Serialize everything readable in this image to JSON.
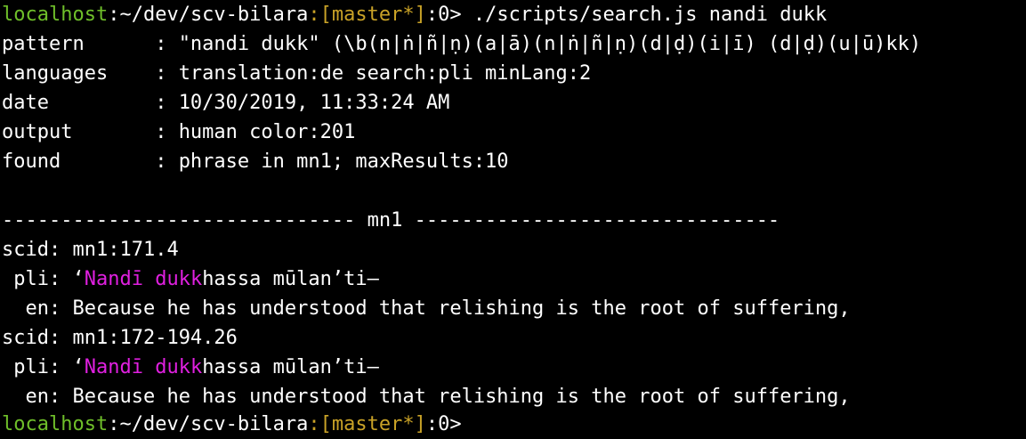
{
  "prompt1": {
    "host": "localhost",
    "sep": ":",
    "path": "~/dev/scv-bilara",
    "branch": ":[master*]",
    "suffix": ":0>",
    "command": " ./scripts/search.js nandi dukk"
  },
  "info": [
    {
      "key": "pattern      ",
      "sep": ": ",
      "value": "\"nandi dukk\" (\\b(n|ṅ|ñ|ṇ)(a|ā)(n|ṅ|ñ|ṇ)(d|ḍ)(i|ī) (d|ḍ)(u|ū)kk)"
    },
    {
      "key": "languages    ",
      "sep": ": ",
      "value": "translation:de search:pli minLang:2"
    },
    {
      "key": "date         ",
      "sep": ": ",
      "value": "10/30/2019, 11:33:24 AM"
    },
    {
      "key": "output       ",
      "sep": ": ",
      "value": "human color:201"
    },
    {
      "key": "found        ",
      "sep": ": ",
      "value": "phrase in mn1; maxResults:10"
    }
  ],
  "divider": "------------------------------ mn1 -------------------------------",
  "results": [
    {
      "scid_label": "scid: ",
      "scid": "mn1:171.4",
      "pli_label": " pli: ",
      "pli_pre": "‘",
      "pli_match": "Nandī dukk",
      "pli_post": "hassa mūlan’ti—",
      "en_label": "  en: ",
      "en": "Because he has understood that relishing is the root of suffering,"
    },
    {
      "scid_label": "scid: ",
      "scid": "mn1:172-194.26",
      "pli_label": " pli: ",
      "pli_pre": "‘",
      "pli_match": "Nandī dukk",
      "pli_post": "hassa mūlan’ti—",
      "en_label": "  en: ",
      "en": "Because he has understood that relishing is the root of suffering,"
    }
  ],
  "prompt2": {
    "host": "localhost",
    "sep": ":",
    "path": "~/dev/scv-bilara",
    "branch": ":[master*]",
    "suffix": ":0>"
  },
  "colors": {
    "background": "#000000",
    "text": "#ffffff",
    "host": "#6fbf2a",
    "branch": "#c9a227",
    "match": "#e020e0"
  }
}
